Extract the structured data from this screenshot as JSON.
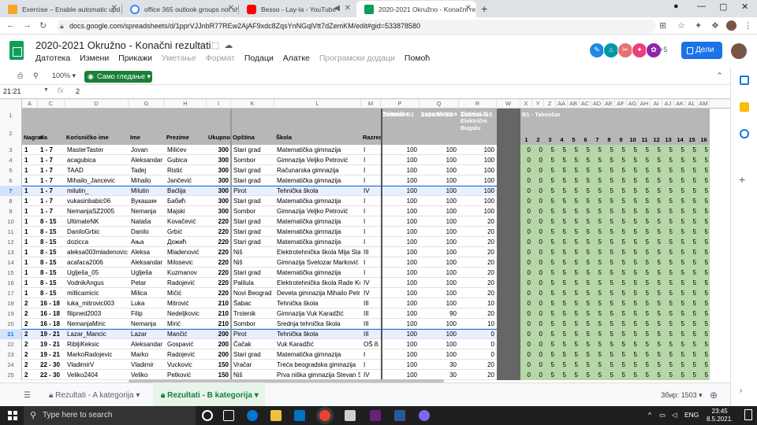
{
  "browser": {
    "tabs": [
      {
        "title": "Exercise – Enable automatic upd",
        "color": "#f5a623"
      },
      {
        "title": "office 365 outlook groups not sh",
        "color": "#4285f4"
      },
      {
        "title": "Besso - Lay-la - YouTube",
        "color": "#ff0000"
      },
      {
        "title": "2020-2021 Okružno - Konačni re",
        "color": "#0f9d58"
      }
    ],
    "url": "docs.google.com/spreadsheets/d/1pprVJJnbR77REw2AjAF9xdc8ZqsYnNGqlVtt7dZemKM/edit#gid=533878580"
  },
  "doc": {
    "title": "2020-2021 Okružno - Konačni rezultati",
    "menu": [
      "Датотека",
      "Измени",
      "Прикажи",
      "Уметање",
      "Формат",
      "Подаци",
      "Алатке",
      "Програмски додаци",
      "Помоћ"
    ],
    "menu_disabled": [
      false,
      false,
      false,
      true,
      true,
      false,
      false,
      true,
      false
    ],
    "more_collaborators": "+5",
    "share_label": "Дели",
    "zoom": "100%",
    "view_only": "Само гледање",
    "name_box": "21:21",
    "formula_value": "2"
  },
  "grid": {
    "columns": [
      {
        "l": "A",
        "w": 20
      },
      {
        "l": "C",
        "w": 34
      },
      {
        "l": "D",
        "w": 81
      },
      {
        "l": "G",
        "w": 46
      },
      {
        "l": "H",
        "w": 53
      },
      {
        "l": "I",
        "w": 31
      },
      {
        "l": "K",
        "w": 55
      },
      {
        "l": "L",
        "w": 110
      },
      {
        "l": "M",
        "w": 25
      },
      {
        "l": "P",
        "w": 49
      },
      {
        "l": "Q",
        "w": 50
      },
      {
        "l": "R",
        "w": 48
      },
      {
        "l": "W",
        "w": 30
      },
      {
        "l": "X",
        "w": 15
      },
      {
        "l": "Y",
        "w": 15
      },
      {
        "l": "Z",
        "w": 15
      },
      {
        "l": "AA",
        "w": 15
      },
      {
        "l": "AB",
        "w": 15
      },
      {
        "l": "AC",
        "w": 15
      },
      {
        "l": "AD",
        "w": 15
      },
      {
        "l": "AE",
        "w": 15
      },
      {
        "l": "AF",
        "w": 15
      },
      {
        "l": "AG",
        "w": 15
      },
      {
        "l": "AH",
        "w": 15
      },
      {
        "l": "AI",
        "w": 15
      },
      {
        "l": "AJ",
        "w": 15
      },
      {
        "l": "AK",
        "w": 15
      },
      {
        "l": "AL",
        "w": 15
      },
      {
        "l": "AM",
        "w": 15
      }
    ],
    "header_row1": {
      "P": "Zadatak B1",
      "Q": "Zadatak B2",
      "R": "Zadatak B3",
      "X": "B1 - Takmičar"
    },
    "header_row2": {
      "A": "Nagrada",
      "C": "#",
      "D": "Korisničko ime",
      "G": "Ime",
      "H": "Prezime",
      "I": "Ukupno",
      "K": "Opština",
      "L": "Škola",
      "M": "Razred",
      "P": "Takmičar",
      "Q": "Lepa Matrica",
      "R": "Zlatnici 2: Električni Bugalu",
      "X": "1",
      "Y": "2",
      "Z": "3",
      "AA": "4",
      "AB": "5",
      "AC": "6",
      "AD": "7",
      "AE": "8",
      "AF": "9",
      "AG": "10",
      "AH": "11",
      "AI": "12",
      "AJ": "13",
      "AK": "14",
      "AL": "15",
      "AM": "16"
    },
    "rows": [
      {
        "n": "3",
        "a": "1",
        "c": "1 - 7",
        "d": "MasterTaster",
        "g": "Jovan",
        "h": "Milićev",
        "i": "300",
        "k": "Stari grad",
        "l": "Matematička gimnazija",
        "m": "I",
        "p": "100",
        "q": "100",
        "r": "100",
        "t": [
          "0",
          "0",
          "5",
          "5",
          "5",
          "5",
          "5",
          "5",
          "5",
          "5",
          "5",
          "5",
          "5",
          "5",
          "5",
          "5"
        ]
      },
      {
        "n": "4",
        "a": "1",
        "c": "1 - 7",
        "d": "acagubica",
        "g": "Aleksandar",
        "h": "Gubica",
        "i": "300",
        "k": "Sombor",
        "l": "Gimnazija Veljko Petrović",
        "m": "I",
        "p": "100",
        "q": "100",
        "r": "100",
        "t": [
          "0",
          "0",
          "5",
          "5",
          "5",
          "5",
          "5",
          "5",
          "5",
          "5",
          "5",
          "5",
          "5",
          "5",
          "5",
          "5"
        ]
      },
      {
        "n": "5",
        "a": "1",
        "c": "1 - 7",
        "d": "TAAD",
        "g": "Tadej",
        "h": "Ristić",
        "i": "300",
        "k": "Stari grad",
        "l": "Računarska gimnazija",
        "m": "I",
        "p": "100",
        "q": "100",
        "r": "100",
        "t": [
          "0",
          "0",
          "5",
          "5",
          "5",
          "5",
          "5",
          "5",
          "5",
          "5",
          "5",
          "5",
          "5",
          "5",
          "5",
          "5"
        ]
      },
      {
        "n": "6",
        "a": "1",
        "c": "1 - 7",
        "d": "Mihailo_Jancevic",
        "g": "Mihailo",
        "h": "Jančević",
        "i": "300",
        "k": "Stari grad",
        "l": "Matematička gimnazija",
        "m": "I",
        "p": "100",
        "q": "100",
        "r": "100",
        "t": [
          "0",
          "0",
          "5",
          "5",
          "5",
          "5",
          "5",
          "5",
          "5",
          "5",
          "5",
          "5",
          "5",
          "5",
          "5",
          "5"
        ]
      },
      {
        "n": "7",
        "a": "1",
        "c": "1 - 7",
        "d": "milutin_",
        "g": "Milutin",
        "h": "Baćlija",
        "i": "300",
        "k": "Pirot",
        "l": "Tehnička škola",
        "m": "IV",
        "p": "100",
        "q": "100",
        "r": "100",
        "t": [
          "0",
          "0",
          "5",
          "5",
          "5",
          "5",
          "5",
          "5",
          "5",
          "5",
          "5",
          "5",
          "5",
          "5",
          "5",
          "5"
        ]
      },
      {
        "n": "8",
        "a": "1",
        "c": "1 - 7",
        "d": "vukasinbabic06",
        "g": "Вукашин",
        "h": "Бабић",
        "i": "300",
        "k": "Stari grad",
        "l": "Matematička gimnazija",
        "m": "I",
        "p": "100",
        "q": "100",
        "r": "100",
        "t": [
          "0",
          "0",
          "5",
          "5",
          "5",
          "5",
          "5",
          "5",
          "5",
          "5",
          "5",
          "5",
          "5",
          "5",
          "5",
          "5"
        ]
      },
      {
        "n": "9",
        "a": "1",
        "c": "1 - 7",
        "d": "NemanjaSZ2005",
        "g": "Nemanja",
        "h": "Majski",
        "i": "300",
        "k": "Sombor",
        "l": "Gimnazija Veljko Petrović",
        "m": "I",
        "p": "100",
        "q": "100",
        "r": "100",
        "t": [
          "0",
          "0",
          "5",
          "5",
          "5",
          "5",
          "5",
          "5",
          "5",
          "5",
          "5",
          "5",
          "5",
          "5",
          "5",
          "5"
        ]
      },
      {
        "n": "10",
        "a": "1",
        "c": "8 - 15",
        "d": "UltimateNK",
        "g": "Nataša",
        "h": "Kovačević",
        "i": "220",
        "k": "Stari grad",
        "l": "Matematička gimnazija",
        "m": "I",
        "p": "100",
        "q": "100",
        "r": "20",
        "t": [
          "0",
          "0",
          "5",
          "5",
          "5",
          "5",
          "5",
          "5",
          "5",
          "5",
          "5",
          "5",
          "5",
          "5",
          "5",
          "5"
        ]
      },
      {
        "n": "11",
        "a": "1",
        "c": "8 - 15",
        "d": "DaniloGrbic",
        "g": "Danilo",
        "h": "Grbić",
        "i": "220",
        "k": "Stari grad",
        "l": "Matematička gimnazija",
        "m": "I",
        "p": "100",
        "q": "100",
        "r": "20",
        "t": [
          "0",
          "0",
          "5",
          "5",
          "5",
          "5",
          "5",
          "5",
          "5",
          "5",
          "5",
          "5",
          "5",
          "5",
          "5",
          "5"
        ]
      },
      {
        "n": "12",
        "a": "1",
        "c": "8 - 15",
        "d": "dozicca",
        "g": "Ања",
        "h": "Дожић",
        "i": "220",
        "k": "Stari grad",
        "l": "Matematička gimnazija",
        "m": "I",
        "p": "100",
        "q": "100",
        "r": "20",
        "t": [
          "0",
          "0",
          "5",
          "5",
          "5",
          "5",
          "5",
          "5",
          "5",
          "5",
          "5",
          "5",
          "5",
          "5",
          "5",
          "5"
        ]
      },
      {
        "n": "13",
        "a": "1",
        "c": "8 - 15",
        "d": "aleksa003mladenovic",
        "g": "Aleksa",
        "h": "Mladenović",
        "i": "220",
        "k": "Niš",
        "l": "Elektrotehnička škola Mija Stani",
        "m": "III",
        "p": "100",
        "q": "100",
        "r": "20",
        "t": [
          "0",
          "0",
          "5",
          "5",
          "5",
          "5",
          "5",
          "5",
          "5",
          "5",
          "5",
          "5",
          "5",
          "5",
          "5",
          "5"
        ]
      },
      {
        "n": "14",
        "a": "1",
        "c": "8 - 15",
        "d": "acafaca2006",
        "g": "Aleksandar",
        "h": "Milosevic",
        "i": "220",
        "k": "Niš",
        "l": "Gimnazija Svetozar Marković",
        "m": "I",
        "p": "100",
        "q": "100",
        "r": "20",
        "t": [
          "0",
          "0",
          "5",
          "5",
          "5",
          "5",
          "5",
          "5",
          "5",
          "5",
          "5",
          "5",
          "5",
          "5",
          "5",
          "5"
        ]
      },
      {
        "n": "15",
        "a": "1",
        "c": "8 - 15",
        "d": "Uglješa_05",
        "g": "Uglješa",
        "h": "Kuzmanov",
        "i": "220",
        "k": "Stari grad",
        "l": "Matematička gimnazija",
        "m": "I",
        "p": "100",
        "q": "100",
        "r": "20",
        "t": [
          "0",
          "0",
          "5",
          "5",
          "5",
          "5",
          "5",
          "5",
          "5",
          "5",
          "5",
          "5",
          "5",
          "5",
          "5",
          "5"
        ]
      },
      {
        "n": "16",
        "a": "1",
        "c": "8 - 15",
        "d": "VodnikAngus",
        "g": "Petar",
        "h": "Radojević",
        "i": "220",
        "k": "Palilula",
        "l": "Elektrotehnička škola Rade Konč",
        "m": "IV",
        "p": "100",
        "q": "100",
        "r": "20",
        "t": [
          "0",
          "0",
          "5",
          "5",
          "5",
          "5",
          "5",
          "5",
          "5",
          "5",
          "5",
          "5",
          "5",
          "5",
          "5",
          "5"
        ]
      },
      {
        "n": "17",
        "a": "1",
        "c": "8 - 15",
        "d": "millicamicic",
        "g": "Milica",
        "h": "Mičić",
        "i": "220",
        "k": "Novi Beograd",
        "l": "Deveta gimnazija Mihailo Petrov",
        "m": "IV",
        "p": "100",
        "q": "100",
        "r": "20",
        "t": [
          "0",
          "0",
          "5",
          "5",
          "5",
          "5",
          "5",
          "5",
          "5",
          "5",
          "5",
          "5",
          "5",
          "5",
          "5",
          "5"
        ]
      },
      {
        "n": "18",
        "a": "2",
        "c": "16 - 18",
        "d": "luka_mitrovic003",
        "g": "Luka",
        "h": "Mitrović",
        "i": "210",
        "k": "Šabac",
        "l": "Tehnička škola",
        "m": "III",
        "p": "100",
        "q": "100",
        "r": "10",
        "t": [
          "0",
          "0",
          "5",
          "5",
          "5",
          "5",
          "5",
          "5",
          "5",
          "5",
          "5",
          "5",
          "5",
          "5",
          "5",
          "5"
        ]
      },
      {
        "n": "19",
        "a": "2",
        "c": "16 - 18",
        "d": "filipned2003",
        "g": "Filip",
        "h": "Nedeljkovic",
        "i": "210",
        "k": "Trstenik",
        "l": "Gimnazija Vuk Karadžić",
        "m": "III",
        "p": "100",
        "q": "90",
        "r": "20",
        "t": [
          "0",
          "0",
          "5",
          "5",
          "5",
          "5",
          "5",
          "5",
          "5",
          "5",
          "5",
          "5",
          "5",
          "5",
          "5",
          "5"
        ]
      },
      {
        "n": "20",
        "a": "2",
        "c": "16 - 18",
        "d": "NemanjaMiric",
        "g": "Nemanja",
        "h": "Mirić",
        "i": "210",
        "k": "Sombor",
        "l": "Srednja tehnička škola",
        "m": "III",
        "p": "100",
        "q": "100",
        "r": "10",
        "t": [
          "0",
          "0",
          "5",
          "5",
          "5",
          "5",
          "5",
          "5",
          "5",
          "5",
          "5",
          "5",
          "5",
          "5",
          "5",
          "5"
        ]
      },
      {
        "n": "21",
        "a": "2",
        "c": "19 - 21",
        "d": "Lazar_Mancic",
        "g": "Lazar",
        "h": "Mančić",
        "i": "200",
        "k": "Pirot",
        "l": "Tehnička škola",
        "m": "III",
        "p": "100",
        "q": "100",
        "r": "0",
        "t": [
          "0",
          "0",
          "5",
          "5",
          "5",
          "5",
          "5",
          "5",
          "5",
          "5",
          "5",
          "5",
          "5",
          "5",
          "5",
          "5"
        ]
      },
      {
        "n": "22",
        "a": "2",
        "c": "19 - 21",
        "d": "RibljiKeksic",
        "g": "Aleksandar",
        "h": "Gospavić",
        "i": "200",
        "k": "Čačak",
        "l": "Vuk Karadžić",
        "m": "OŠ 8.",
        "p": "100",
        "q": "100",
        "r": "0",
        "t": [
          "0",
          "0",
          "5",
          "5",
          "5",
          "5",
          "5",
          "5",
          "5",
          "5",
          "5",
          "5",
          "5",
          "5",
          "5",
          "5"
        ]
      },
      {
        "n": "23",
        "a": "2",
        "c": "19 - 21",
        "d": "MarkoRadojevic",
        "g": "Marko",
        "h": "Radojević",
        "i": "200",
        "k": "Stari grad",
        "l": "Matematička gimnazija",
        "m": "I",
        "p": "100",
        "q": "100",
        "r": "0",
        "t": [
          "0",
          "0",
          "5",
          "5",
          "5",
          "5",
          "5",
          "5",
          "5",
          "5",
          "5",
          "5",
          "5",
          "5",
          "5",
          "5"
        ]
      },
      {
        "n": "24",
        "a": "2",
        "c": "22 - 30",
        "d": "VladimirV",
        "g": "Vladimir",
        "h": "Vuckovic",
        "i": "150",
        "k": "Vračar",
        "l": "Treća beogradska gimnazija",
        "m": "I",
        "p": "100",
        "q": "30",
        "r": "20",
        "t": [
          "0",
          "0",
          "5",
          "5",
          "5",
          "5",
          "5",
          "5",
          "5",
          "5",
          "5",
          "5",
          "5",
          "5",
          "5",
          "5"
        ]
      },
      {
        "n": "25",
        "a": "2",
        "c": "22 - 30",
        "d": "Veliko2404",
        "g": "Veliko",
        "h": "Petković",
        "i": "150",
        "k": "Niš",
        "l": "Prva niška gimnazija Stevan Srem",
        "m": "IV",
        "p": "100",
        "q": "30",
        "r": "20",
        "t": [
          "0",
          "0",
          "5",
          "5",
          "5",
          "5",
          "5",
          "5",
          "5",
          "5",
          "5",
          "5",
          "5",
          "5",
          "5",
          "5"
        ]
      }
    ],
    "selected_rows": [
      "7",
      "21"
    ]
  },
  "sheets": {
    "tabs": [
      "Rezultati - A kategorija",
      "Rezultati - B kategorija"
    ],
    "active": 1,
    "explore_label": "Збир: 1503"
  },
  "taskbar": {
    "search_placeholder": "Type here to search",
    "lang": "ENG",
    "time": "23:45",
    "date": "8.5.2021."
  },
  "colors": {
    "sheets_green": "#0f9d58",
    "share_blue": "#1a73e8",
    "score_green": "#b6d7a8",
    "view_only_green": "#188038"
  }
}
